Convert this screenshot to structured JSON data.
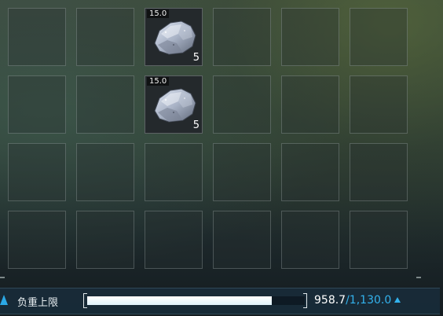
{
  "inventory": {
    "slots": [
      {
        "filled": false
      },
      {
        "filled": false
      },
      {
        "filled": true,
        "weight": "15.0",
        "quantity": "5",
        "icon": "stone-icon"
      },
      {
        "filled": false
      },
      {
        "filled": false
      },
      {
        "filled": false
      },
      {
        "filled": false
      },
      {
        "filled": false
      },
      {
        "filled": true,
        "weight": "15.0",
        "quantity": "5",
        "icon": "stone-icon"
      },
      {
        "filled": false
      },
      {
        "filled": false
      },
      {
        "filled": false
      },
      {
        "filled": false
      },
      {
        "filled": false
      },
      {
        "filled": false
      },
      {
        "filled": false
      },
      {
        "filled": false
      },
      {
        "filled": false
      },
      {
        "filled": false
      },
      {
        "filled": false
      },
      {
        "filled": false
      },
      {
        "filled": false
      },
      {
        "filled": false
      },
      {
        "filled": false
      }
    ]
  },
  "capacity": {
    "label": "负重上限",
    "current": "958.7",
    "max": "/1,130.0",
    "fill_fraction": 0.848,
    "accent_color": "#33b3ee"
  }
}
